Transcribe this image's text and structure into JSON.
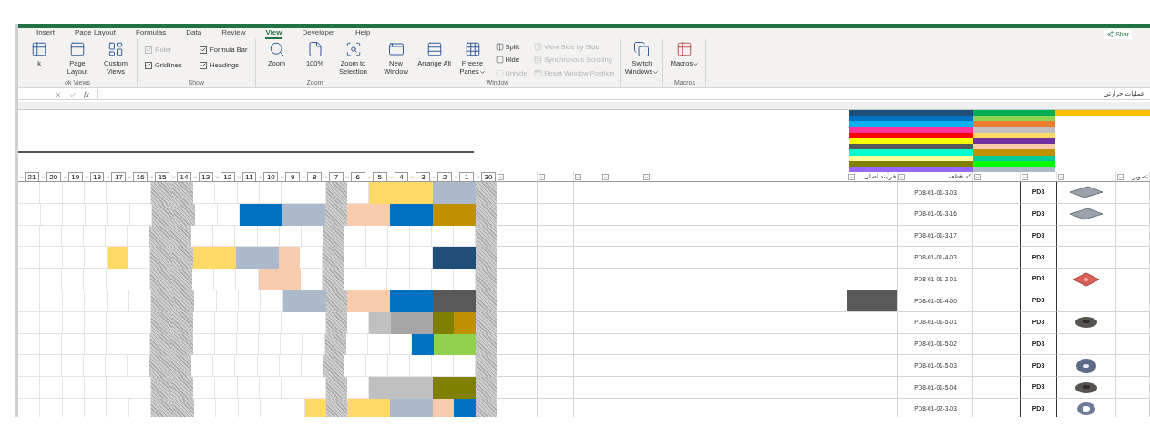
{
  "ribbon": {
    "tabs": [
      {
        "label": "Insert",
        "selected": false
      },
      {
        "label": "Page Layout",
        "selected": false
      },
      {
        "label": "Formulas",
        "selected": false
      },
      {
        "label": "Data",
        "selected": false
      },
      {
        "label": "Review",
        "selected": false
      },
      {
        "label": "View",
        "selected": true
      },
      {
        "label": "Developer",
        "selected": false
      },
      {
        "label": "Help",
        "selected": false
      }
    ],
    "share": "Shar",
    "groups": [
      {
        "label": "ok Views",
        "items": [
          {
            "kind": "large",
            "label": "k",
            "disabled": false
          },
          {
            "kind": "large",
            "label": "Page Layout",
            "disabled": false
          },
          {
            "kind": "large",
            "label": "Custom Views",
            "disabled": false
          }
        ]
      },
      {
        "label": "Show",
        "items": [
          {
            "kind": "checkbox",
            "label": "Ruler",
            "checked": true,
            "disabled": true
          },
          {
            "kind": "checkbox",
            "label": "Formula Bar",
            "checked": true,
            "disabled": false
          },
          {
            "kind": "checkbox",
            "label": "Gridlines",
            "checked": true,
            "disabled": false
          },
          {
            "kind": "checkbox",
            "label": "Headings",
            "checked": true,
            "disabled": false
          }
        ]
      },
      {
        "label": "Zoom",
        "items": [
          {
            "kind": "large",
            "label": "Zoom",
            "disabled": false
          },
          {
            "kind": "large",
            "label": "100%",
            "disabled": false
          },
          {
            "kind": "large",
            "label": "Zoom to Selection",
            "disabled": false
          }
        ]
      },
      {
        "label": "Window",
        "items": [
          {
            "kind": "large",
            "label": "New Window",
            "disabled": false
          },
          {
            "kind": "large",
            "label": "Arrange All",
            "disabled": false
          },
          {
            "kind": "large",
            "label": "Freeze Panes",
            "disabled": false,
            "dropdown": true
          },
          {
            "kind": "small",
            "label": "Split",
            "disabled": false
          },
          {
            "kind": "small",
            "label": "Hide",
            "disabled": false
          },
          {
            "kind": "small",
            "label": "Unhide",
            "disabled": true
          },
          {
            "kind": "small",
            "label": "View Side by Side",
            "disabled": true
          },
          {
            "kind": "small",
            "label": "Synchronous Scrolling",
            "disabled": true
          },
          {
            "kind": "small",
            "label": "Reset Window Position",
            "disabled": true
          }
        ]
      },
      {
        "items": [
          {
            "kind": "large",
            "label": "Switch Windows",
            "disabled": false,
            "dropdown": true
          }
        ]
      },
      {
        "label": "Macros",
        "items": [
          {
            "kind": "large",
            "label": "Macros",
            "disabled": false,
            "dropdown": true
          }
        ]
      }
    ]
  },
  "formula_bar": {
    "function_label": "fx",
    "value": "عملیات حرارتی"
  },
  "legend": {
    "columns": [
      [
        {
          "color": "#1f4e79"
        },
        {
          "color": "#0070c0"
        },
        {
          "color": "#00b0f0"
        },
        {
          "color": "#ff3399"
        },
        {
          "color": "#ff0000"
        },
        {
          "color": "#ffff00"
        },
        {
          "color": "#595959"
        },
        {
          "color": "#00ffcc"
        },
        {
          "color": "#ffff99"
        },
        {
          "color": "#808000"
        },
        {
          "color": "#9966ff"
        }
      ],
      [
        {
          "color": "#00b050"
        },
        {
          "color": "#92d050"
        },
        {
          "color": "#ed7d31"
        },
        {
          "color": "#c0c0c0"
        },
        {
          "color": "#ffd966"
        },
        {
          "color": "#7030a0"
        },
        {
          "color": "#f8cbad"
        },
        {
          "color": "#bf9000"
        },
        {
          "color": "#00cc99"
        },
        {
          "color": "#00ff00"
        },
        {
          "color": "#acb9ca"
        }
      ],
      [
        {
          "color": "#ffc000"
        }
      ]
    ]
  },
  "timeline_headers": [
    "21",
    "20",
    "19",
    "18",
    "17",
    "16",
    "15",
    "14",
    "13",
    "12",
    "11",
    "10",
    "9",
    "8",
    "7",
    "6",
    "5",
    "4",
    "3",
    "2",
    "1",
    "30"
  ],
  "headings": {
    "image": "تصویر",
    "code": "کد قطعه",
    "process": "فرآیند اصلی"
  },
  "rows": [
    {
      "cells": [
        {
          "kind": "blank"
        },
        {
          "kind": "blank"
        },
        {
          "kind": "blank"
        },
        {
          "kind": "blank"
        },
        {
          "kind": "blank"
        },
        {
          "kind": "blank"
        },
        {
          "kind": "shaded"
        },
        {
          "kind": "shaded"
        },
        {
          "kind": "blank"
        },
        {
          "kind": "blank"
        },
        {
          "kind": "blank"
        },
        {
          "kind": "blank"
        },
        {
          "kind": "blank"
        },
        {
          "kind": "blank"
        },
        {
          "kind": "shaded"
        },
        {
          "kind": "blank"
        },
        {
          "kind": "fill",
          "color": "#ffd966"
        },
        {
          "kind": "fill",
          "color": "#ffd966"
        },
        {
          "kind": "fill",
          "color": "#ffd966"
        },
        {
          "kind": "fill",
          "color": "#acb9ca"
        },
        {
          "kind": "fill",
          "color": "#acb9ca"
        },
        {
          "kind": "shaded"
        }
      ],
      "highlighted": false,
      "code": "PD8-01-01-3-03",
      "project": "PD8",
      "thumbnail": {
        "kind": "plate"
      }
    },
    {
      "cells": [
        {
          "kind": "blank"
        },
        {
          "kind": "blank"
        },
        {
          "kind": "blank"
        },
        {
          "kind": "blank"
        },
        {
          "kind": "blank"
        },
        {
          "kind": "blank"
        },
        {
          "kind": "shaded"
        },
        {
          "kind": "shaded"
        },
        {
          "kind": "blank"
        },
        {
          "kind": "blank"
        },
        {
          "kind": "fill",
          "color": "#0070c0"
        },
        {
          "kind": "fill",
          "color": "#0070c0"
        },
        {
          "kind": "fill",
          "color": "#acb9ca"
        },
        {
          "kind": "fill",
          "color": "#acb9ca"
        },
        {
          "kind": "shaded"
        },
        {
          "kind": "fill",
          "color": "#f8cbad"
        },
        {
          "kind": "fill",
          "color": "#f8cbad"
        },
        {
          "kind": "fill",
          "color": "#0070c0"
        },
        {
          "kind": "fill",
          "color": "#0070c0"
        },
        {
          "kind": "fill",
          "color": "#bf9000"
        },
        {
          "kind": "fill",
          "color": "#bf9000"
        },
        {
          "kind": "shaded"
        }
      ],
      "highlighted": false,
      "code": "PD8-01-01-3-16",
      "project": "PD8",
      "thumbnail": {
        "kind": "plate"
      }
    },
    {
      "cells": [
        {
          "kind": "blank"
        },
        {
          "kind": "blank"
        },
        {
          "kind": "blank"
        },
        {
          "kind": "blank"
        },
        {
          "kind": "blank"
        },
        {
          "kind": "blank"
        },
        {
          "kind": "shaded"
        },
        {
          "kind": "shaded"
        },
        {
          "kind": "blank"
        },
        {
          "kind": "blank"
        },
        {
          "kind": "blank"
        },
        {
          "kind": "blank"
        },
        {
          "kind": "blank"
        },
        {
          "kind": "blank"
        },
        {
          "kind": "shaded"
        },
        {
          "kind": "blank"
        },
        {
          "kind": "blank"
        },
        {
          "kind": "blank"
        },
        {
          "kind": "blank"
        },
        {
          "kind": "blank"
        },
        {
          "kind": "blank"
        },
        {
          "kind": "shaded"
        }
      ],
      "highlighted": false,
      "code": "PD8-01-01-3-17",
      "project": "PD8"
    },
    {
      "cells": [
        {
          "kind": "blank"
        },
        {
          "kind": "blank"
        },
        {
          "kind": "blank"
        },
        {
          "kind": "blank"
        },
        {
          "kind": "fill",
          "color": "#ffd966"
        },
        {
          "kind": "blank"
        },
        {
          "kind": "shaded"
        },
        {
          "kind": "shaded"
        },
        {
          "kind": "fill",
          "color": "#ffd966"
        },
        {
          "kind": "fill",
          "color": "#ffd966"
        },
        {
          "kind": "fill",
          "color": "#acb9ca"
        },
        {
          "kind": "fill",
          "color": "#acb9ca"
        },
        {
          "kind": "fill",
          "color": "#f8cbad"
        },
        {
          "kind": "blank"
        },
        {
          "kind": "shaded"
        },
        {
          "kind": "blank"
        },
        {
          "kind": "blank"
        },
        {
          "kind": "blank"
        },
        {
          "kind": "blank"
        },
        {
          "kind": "fill",
          "color": "#1f4e79"
        },
        {
          "kind": "fill",
          "color": "#1f4e79"
        },
        {
          "kind": "shaded"
        }
      ],
      "highlighted": false,
      "code": "PD8-01-01-4-03",
      "project": "PD8"
    },
    {
      "cells": [
        {
          "kind": "blank"
        },
        {
          "kind": "blank"
        },
        {
          "kind": "blank"
        },
        {
          "kind": "blank"
        },
        {
          "kind": "blank"
        },
        {
          "kind": "blank"
        },
        {
          "kind": "shaded"
        },
        {
          "kind": "shaded"
        },
        {
          "kind": "blank"
        },
        {
          "kind": "blank"
        },
        {
          "kind": "blank"
        },
        {
          "kind": "fill",
          "color": "#f8cbad"
        },
        {
          "kind": "fill",
          "color": "#f8cbad"
        },
        {
          "kind": "blank"
        },
        {
          "kind": "shaded"
        },
        {
          "kind": "blank"
        },
        {
          "kind": "blank"
        },
        {
          "kind": "blank"
        },
        {
          "kind": "blank"
        },
        {
          "kind": "blank"
        },
        {
          "kind": "blank"
        },
        {
          "kind": "shaded"
        }
      ],
      "highlighted": false,
      "code": "PD8-01-01-2-01",
      "project": "PD8",
      "thumbnail": {
        "kind": "red-plate"
      }
    },
    {
      "cells": [
        {
          "kind": "blank"
        },
        {
          "kind": "blank"
        },
        {
          "kind": "blank"
        },
        {
          "kind": "blank"
        },
        {
          "kind": "blank"
        },
        {
          "kind": "blank"
        },
        {
          "kind": "shaded"
        },
        {
          "kind": "shaded"
        },
        {
          "kind": "blank"
        },
        {
          "kind": "blank"
        },
        {
          "kind": "blank"
        },
        {
          "kind": "blank"
        },
        {
          "kind": "fill",
          "color": "#acb9ca"
        },
        {
          "kind": "fill",
          "color": "#acb9ca"
        },
        {
          "kind": "shaded"
        },
        {
          "kind": "fill",
          "color": "#f8cbad"
        },
        {
          "kind": "fill",
          "color": "#f8cbad"
        },
        {
          "kind": "fill",
          "color": "#0070c0"
        },
        {
          "kind": "fill",
          "color": "#0070c0"
        },
        {
          "kind": "fill",
          "color": "#595959"
        },
        {
          "kind": "fill",
          "color": "#595959"
        },
        {
          "kind": "shaded"
        }
      ],
      "highlighted": true,
      "code": "PD8-01-01-4-00",
      "project": "PD8"
    },
    {
      "cells": [
        {
          "kind": "blank"
        },
        {
          "kind": "blank"
        },
        {
          "kind": "blank"
        },
        {
          "kind": "blank"
        },
        {
          "kind": "blank"
        },
        {
          "kind": "blank"
        },
        {
          "kind": "shaded"
        },
        {
          "kind": "shaded"
        },
        {
          "kind": "blank"
        },
        {
          "kind": "blank"
        },
        {
          "kind": "blank"
        },
        {
          "kind": "blank"
        },
        {
          "kind": "blank"
        },
        {
          "kind": "blank"
        },
        {
          "kind": "shaded"
        },
        {
          "kind": "blank"
        },
        {
          "kind": "fill",
          "color": "#c0c0c0"
        },
        {
          "kind": "fill",
          "color": "#a6a6a6"
        },
        {
          "kind": "fill",
          "color": "#a6a6a6"
        },
        {
          "kind": "fill",
          "color": "#7f7f00"
        },
        {
          "kind": "fill",
          "color": "#bf9000"
        },
        {
          "kind": "shaded"
        }
      ],
      "highlighted": false,
      "code": "PD8-01-01-5-01",
      "project": "PD8",
      "thumbnail": {
        "kind": "washer"
      }
    },
    {
      "cells": [
        {
          "kind": "blank"
        },
        {
          "kind": "blank"
        },
        {
          "kind": "blank"
        },
        {
          "kind": "blank"
        },
        {
          "kind": "blank"
        },
        {
          "kind": "blank"
        },
        {
          "kind": "shaded"
        },
        {
          "kind": "shaded"
        },
        {
          "kind": "blank"
        },
        {
          "kind": "blank"
        },
        {
          "kind": "blank"
        },
        {
          "kind": "blank"
        },
        {
          "kind": "blank"
        },
        {
          "kind": "blank"
        },
        {
          "kind": "shaded"
        },
        {
          "kind": "blank"
        },
        {
          "kind": "blank"
        },
        {
          "kind": "blank"
        },
        {
          "kind": "fill",
          "color": "#0070c0"
        },
        {
          "kind": "fill",
          "color": "#92d050"
        },
        {
          "kind": "fill",
          "color": "#92d050"
        },
        {
          "kind": "shaded"
        }
      ],
      "highlighted": false,
      "code": "PD8-01-01-5-02",
      "project": "PD8"
    },
    {
      "cells": [
        {
          "kind": "blank"
        },
        {
          "kind": "blank"
        },
        {
          "kind": "blank"
        },
        {
          "kind": "blank"
        },
        {
          "kind": "blank"
        },
        {
          "kind": "blank"
        },
        {
          "kind": "shaded"
        },
        {
          "kind": "shaded"
        },
        {
          "kind": "blank"
        },
        {
          "kind": "blank"
        },
        {
          "kind": "blank"
        },
        {
          "kind": "blank"
        },
        {
          "kind": "blank"
        },
        {
          "kind": "blank"
        },
        {
          "kind": "shaded"
        },
        {
          "kind": "blank"
        },
        {
          "kind": "blank"
        },
        {
          "kind": "blank"
        },
        {
          "kind": "blank"
        },
        {
          "kind": "blank"
        },
        {
          "kind": "blank"
        },
        {
          "kind": "shaded"
        }
      ],
      "highlighted": false,
      "code": "PD8-01-01-5-03",
      "project": "PD8",
      "thumbnail": {
        "kind": "disk"
      }
    },
    {
      "cells": [
        {
          "kind": "blank"
        },
        {
          "kind": "blank"
        },
        {
          "kind": "blank"
        },
        {
          "kind": "blank"
        },
        {
          "kind": "blank"
        },
        {
          "kind": "blank"
        },
        {
          "kind": "shaded"
        },
        {
          "kind": "shaded"
        },
        {
          "kind": "blank"
        },
        {
          "kind": "blank"
        },
        {
          "kind": "blank"
        },
        {
          "kind": "blank"
        },
        {
          "kind": "blank"
        },
        {
          "kind": "blank"
        },
        {
          "kind": "shaded"
        },
        {
          "kind": "blank"
        },
        {
          "kind": "fill",
          "color": "#c0c0c0"
        },
        {
          "kind": "fill",
          "color": "#c0c0c0"
        },
        {
          "kind": "fill",
          "color": "#c0c0c0"
        },
        {
          "kind": "fill",
          "color": "#808000"
        },
        {
          "kind": "fill",
          "color": "#808000"
        },
        {
          "kind": "shaded"
        }
      ],
      "highlighted": false,
      "code": "PD8-01-01-5-04",
      "project": "PD8",
      "thumbnail": {
        "kind": "washer"
      }
    },
    {
      "cells": [
        {
          "kind": "blank"
        },
        {
          "kind": "blank"
        },
        {
          "kind": "blank"
        },
        {
          "kind": "blank"
        },
        {
          "kind": "blank"
        },
        {
          "kind": "blank"
        },
        {
          "kind": "shaded"
        },
        {
          "kind": "shaded"
        },
        {
          "kind": "blank"
        },
        {
          "kind": "blank"
        },
        {
          "kind": "blank"
        },
        {
          "kind": "blank"
        },
        {
          "kind": "blank"
        },
        {
          "kind": "fill",
          "color": "#ffd966"
        },
        {
          "kind": "shaded"
        },
        {
          "kind": "fill",
          "color": "#ffd966"
        },
        {
          "kind": "fill",
          "color": "#ffd966"
        },
        {
          "kind": "fill",
          "color": "#acb9ca"
        },
        {
          "kind": "fill",
          "color": "#acb9ca"
        },
        {
          "kind": "fill",
          "color": "#f8cbad"
        },
        {
          "kind": "fill",
          "color": "#0070c0"
        },
        {
          "kind": "shaded"
        }
      ],
      "highlighted": false,
      "code": "PD8-01-02-3-03",
      "project": "PD8",
      "thumbnail": {
        "kind": "ring"
      }
    }
  ]
}
